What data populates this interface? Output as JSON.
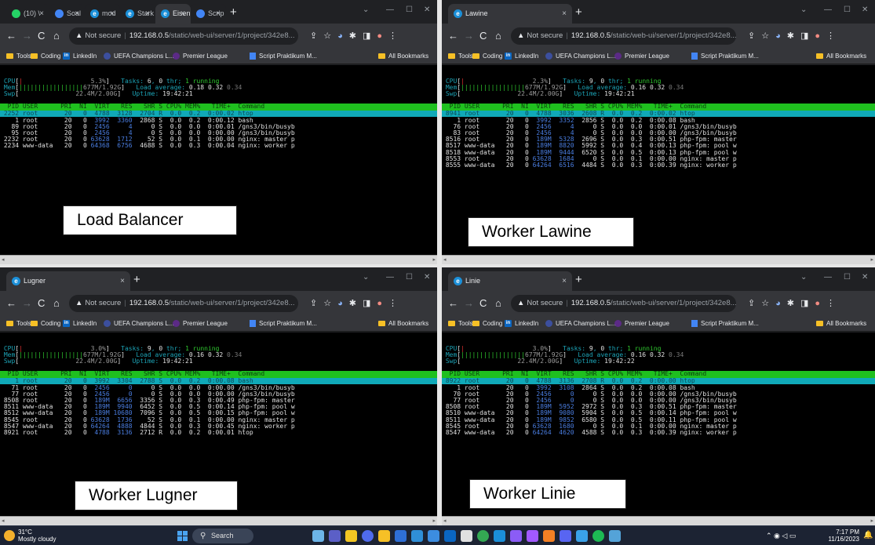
{
  "windows": [
    {
      "tabs": [
        "(10) \\",
        "Soal",
        "mod",
        "Stark",
        "Eisen",
        "Scrip"
      ],
      "active_tab": 4,
      "tab_icons": [
        "whatsapp-icon",
        "doc-icon",
        "edge-icon",
        "edge-icon",
        "edge-icon",
        "doc-icon"
      ],
      "address": {
        "warning": "Not secure",
        "host": "192.168.0.5",
        "path": "/static/web-ui/server/1/project/342e8..."
      },
      "bookmarks": [
        "Tools",
        "Coding",
        "LinkedIn",
        "UEFA Champions L...",
        "Premier League",
        "Script Praktikum M..."
      ],
      "all_bookmarks": "All Bookmarks",
      "htop": {
        "cpu_pct": "5.3%",
        "mem": "677M/1.92G",
        "swp": "22.4M/2.00G",
        "tasks": "6",
        "thr": "0",
        "running": "1",
        "load": [
          "0.18",
          "0.32",
          "0.34"
        ],
        "uptime": "19:42:21",
        "header": "  PID USER      PRI  NI  VIRT   RES   SHR S CPU% MEM%   TIME+  Command",
        "selected": " 2252 root       20   0  4788  3128  2704 R  0.0  0.2  0:00.02 htop",
        "rows": [
          [
            "    1 root       20   0  ",
            "3992  3360  ",
            "2868 S  0.0  0.2  0:00.12 bash"
          ],
          [
            "   89 root       20   0  ",
            "2456     4  ",
            "   0 S  0.0  0.0  0:00.01 /gns3/bin/busyb"
          ],
          [
            "   95 root       20   0  ",
            "2456     4  ",
            "   0 S  0.0  0.0  0:00.00 /gns3/bin/busyb"
          ],
          [
            " 2232 root       20   0 ",
            "63628  1712  ",
            "  52 S  0.0  0.1  0:00.00 nginx: master p"
          ],
          [
            " 2234 www-data   20   0 ",
            "64368  6756  ",
            "4688 S  0.0  0.3  0:00.04 nginx: worker p"
          ]
        ]
      },
      "label": "Load Balancer"
    },
    {
      "tabs": [
        "Lawine"
      ],
      "active_tab": 0,
      "tab_icons": [
        "edge-icon"
      ],
      "address": {
        "warning": "Not secure",
        "host": "192.168.0.5",
        "path": "/static/web-ui/server/1/project/342e8..."
      },
      "bookmarks": [
        "Tools",
        "Coding",
        "LinkedIn",
        "UEFA Champions L...",
        "Premier League",
        "Script Praktikum M..."
      ],
      "all_bookmarks": "All Bookmarks",
      "htop": {
        "cpu_pct": "2.3%",
        "mem": "677M/1.92G",
        "swp": "22.4M/2.00G",
        "tasks": "9",
        "thr": "0",
        "running": "1",
        "load": [
          "0.16",
          "0.32",
          "0.34"
        ],
        "uptime": "19:42:21",
        "header": "  PID USER      PRI  NI  VIRT   RES   SHR S CPU% MEM%   TIME+  Command",
        "selected": " 8941 root       20   0  4788  3036  2608 R  0.0  0.2  0:00.02 htop",
        "rows": [
          [
            "    1 root       20   0  ",
            "3992  3352  ",
            "2856 S  0.0  0.2  0:00.08 bash"
          ],
          [
            "   76 root       20   0  ",
            "2456     4  ",
            "   0 S  0.0  0.0  0:00.01 /gns3/bin/busyb"
          ],
          [
            "   83 root       20   0  ",
            "2456     4  ",
            "   0 S  0.0  0.0  0:00.00 /gns3/bin/busyb"
          ],
          [
            " 8516 root       20   0  ",
            "189M  5328  ",
            "2696 S  0.0  0.3  0:00.51 php-fpm: master"
          ],
          [
            " 8517 www-data   20   0  ",
            "189M  8820  ",
            "5992 S  0.0  0.4  0:00.13 php-fpm: pool w"
          ],
          [
            " 8518 www-data   20   0  ",
            "189M  9444  ",
            "6520 S  0.0  0.5  0:00.13 php-fpm: pool w"
          ],
          [
            " 8553 root       20   0 ",
            "63628  1684  ",
            "   0 S  0.0  0.1  0:00.00 nginx: master p"
          ],
          [
            " 8555 www-data   20   0 ",
            "64264  6516  ",
            "4484 S  0.0  0.3  0:00.39 nginx: worker p"
          ]
        ]
      },
      "label": "Worker Lawine"
    },
    {
      "tabs": [
        "Lugner"
      ],
      "active_tab": 0,
      "tab_icons": [
        "edge-icon"
      ],
      "address": {
        "warning": "Not secure",
        "host": "192.168.0.5",
        "path": "/static/web-ui/server/1/project/342e8..."
      },
      "bookmarks": [
        "Tools",
        "Coding",
        "LinkedIn",
        "UEFA Champions L...",
        "Premier League",
        "Script Praktikum M..."
      ],
      "all_bookmarks": "All Bookmarks",
      "htop": {
        "cpu_pct": "3.0%",
        "mem": "677M/1.92G",
        "swp": "22.4M/2.00G",
        "tasks": "9",
        "thr": "0",
        "running": "1",
        "load": [
          "0.16",
          "0.32",
          "0.34"
        ],
        "uptime": "19:42:21",
        "header": "  PID USER      PRI  NI  VIRT   RES   SHR S CPU% MEM%   TIME+  Command",
        "selected": "    1 root       20   0  3992  3304  2788 S  0.0  0.2  0:00.08 bash",
        "rows": [
          [
            "   71 root       20   0  ",
            "2456     0  ",
            "   0 S  0.0  0.0  0:00.00 /gns3/bin/busyb"
          ],
          [
            "   77 root       20   0  ",
            "2456     0  ",
            "   0 S  0.0  0.0  0:00.00 /gns3/bin/busyb"
          ],
          [
            " 8508 root       20   0  ",
            "189M  6656  ",
            "3356 S  0.0  0.3  0:00.49 php-fpm: master"
          ],
          [
            " 8511 www-data   20   0  ",
            "189M  9940  ",
            "6452 S  0.0  0.5  0:00.14 php-fpm: pool w"
          ],
          [
            " 8512 www-data   20   0  ",
            "189M 10680  ",
            "7096 S  0.0  0.5  0:00.15 php-fpm: pool w"
          ],
          [
            " 8545 root       20   0 ",
            "63628  1736  ",
            "  52 S  0.0  0.1  0:00.00 nginx: master p"
          ],
          [
            " 8547 www-data   20   0 ",
            "64264  4888  ",
            "4844 S  0.0  0.3  0:00.45 nginx: worker p"
          ],
          [
            " 8921 root       20   0  ",
            "4788  3136  ",
            "2712 R  0.0  0.2  0:00.01 htop"
          ]
        ]
      },
      "label": "Worker Lugner"
    },
    {
      "tabs": [
        "Linie"
      ],
      "active_tab": 0,
      "tab_icons": [
        "edge-icon"
      ],
      "address": {
        "warning": "Not secure",
        "host": "192.168.0.5",
        "path": "/static/web-ui/server/1/project/342e8..."
      },
      "bookmarks": [
        "Tools",
        "Coding",
        "LinkedIn",
        "UEFA Champions L...",
        "Premier League",
        "Script Praktikum M..."
      ],
      "all_bookmarks": "All Bookmarks",
      "htop": {
        "cpu_pct": "3.0%",
        "mem": "677M/1.92G",
        "swp": "22.4M/2.00G",
        "tasks": "9",
        "thr": "0",
        "running": "1",
        "load": [
          "0.16",
          "0.32",
          "0.34"
        ],
        "uptime": "19:42:22",
        "header": "  PID USER      PRI  NI  VIRT   RES   SHR S CPU% MEM%   TIME+  Command",
        "selected": " 8922 root       20   0  4788  3136  2708 R  0.0  0.2  0:00.00 htop",
        "rows": [
          [
            "    1 root       20   0  ",
            "3992  3108  ",
            "2864 S  0.0  0.2  0:00.08 bash"
          ],
          [
            "   70 root       20   0  ",
            "2456     0  ",
            "   0 S  0.0  0.0  0:00.00 /gns3/bin/busyb"
          ],
          [
            "   77 root       20   0  ",
            "2456     0  ",
            "   0 S  0.0  0.0  0:00.00 /gns3/bin/busyb"
          ],
          [
            " 8508 root       20   0  ",
            "189M  5952  ",
            "2972 S  0.0  0.3  0:00.51 php-fpm: master"
          ],
          [
            " 8510 www-data   20   0  ",
            "189M  9080  ",
            "5904 S  0.0  0.5  0:00.14 php-fpm: pool w"
          ],
          [
            " 8511 www-data   20   0  ",
            "189M  9852  ",
            "6580 S  0.0  0.5  0:00.11 php-fpm: pool w"
          ],
          [
            " 8545 root       20   0 ",
            "63628  1680  ",
            "   0 S  0.0  0.1  0:00.00 nginx: master p"
          ],
          [
            " 8547 www-data   20   0 ",
            "64264  4620  ",
            "4588 S  0.0  0.3  0:00.39 nginx: worker p"
          ]
        ]
      },
      "label": "Worker Linie"
    }
  ],
  "taskbar": {
    "weather_temp": "31°C",
    "weather_desc": "Mostly cloudy",
    "search_label": "Search",
    "time": "7:17 PM",
    "date": "11/16/2023",
    "tray_icons": [
      "chevron-up-icon",
      "wifi-icon",
      "volume-icon",
      "battery-icon",
      "notification-icon"
    ]
  },
  "colors": {
    "htop_header": "#1fc01f",
    "htop_selected": "#10a9b8",
    "chrome_bg": "#202124",
    "taskbar": "#1c2333"
  }
}
